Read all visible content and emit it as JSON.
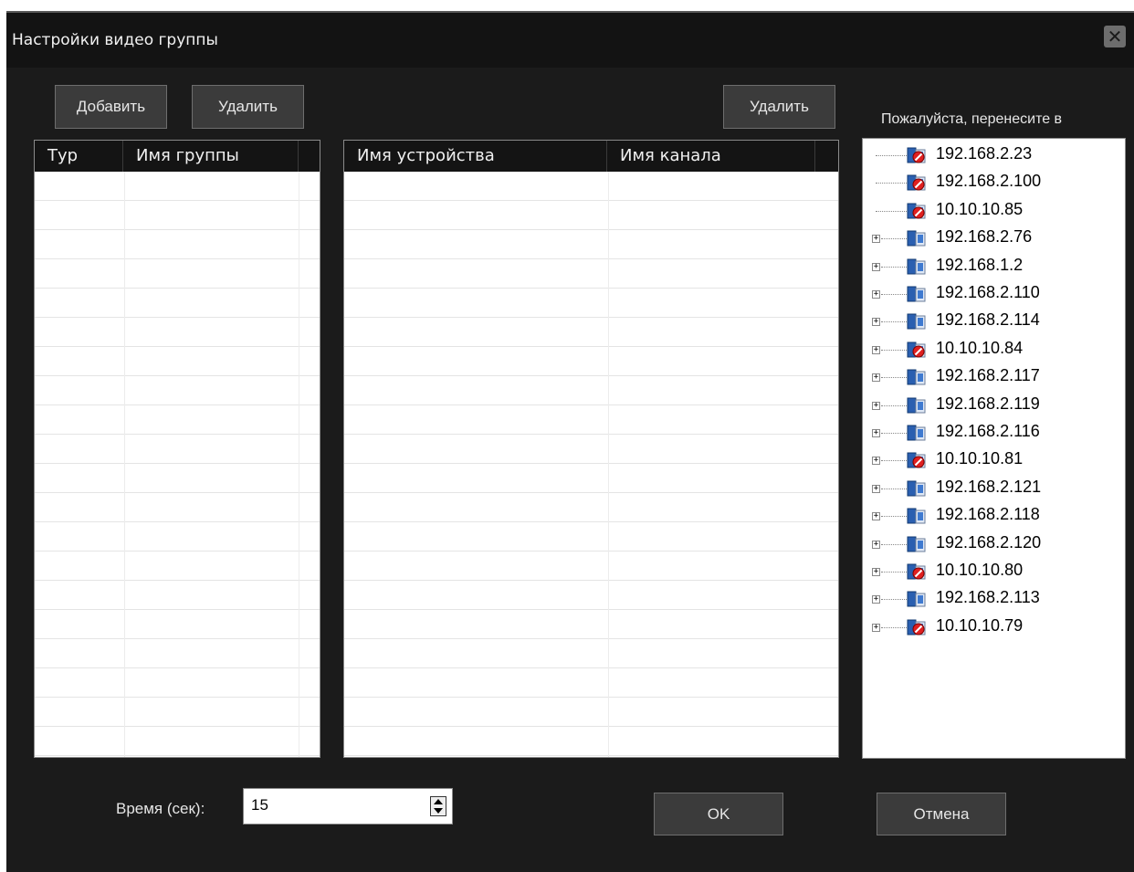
{
  "dialog": {
    "title": "Настройки видео группы",
    "close_icon": "close-icon"
  },
  "left_toolbar": {
    "add_label": "Добавить",
    "delete_label": "Удалить"
  },
  "middle_toolbar": {
    "delete_label": "Удалить"
  },
  "groups_table": {
    "columns": [
      "Тур",
      "Имя группы"
    ]
  },
  "channels_table": {
    "columns": [
      "Имя устройства",
      "Имя канала"
    ]
  },
  "device_tree": {
    "hint": "Пожалуйста, перенесите в",
    "nodes": [
      {
        "ip": "192.168.2.23",
        "status": "offline",
        "expandable": false
      },
      {
        "ip": "192.168.2.100",
        "status": "offline",
        "expandable": false
      },
      {
        "ip": "10.10.10.85",
        "status": "offline",
        "expandable": false
      },
      {
        "ip": "192.168.2.76",
        "status": "online",
        "expandable": true
      },
      {
        "ip": "192.168.1.2",
        "status": "online",
        "expandable": true
      },
      {
        "ip": "192.168.2.110",
        "status": "online",
        "expandable": true
      },
      {
        "ip": "192.168.2.114",
        "status": "online",
        "expandable": true
      },
      {
        "ip": "10.10.10.84",
        "status": "offline",
        "expandable": true
      },
      {
        "ip": "192.168.2.117",
        "status": "online",
        "expandable": true
      },
      {
        "ip": "192.168.2.119",
        "status": "online",
        "expandable": true
      },
      {
        "ip": "192.168.2.116",
        "status": "online",
        "expandable": true
      },
      {
        "ip": "10.10.10.81",
        "status": "offline",
        "expandable": true
      },
      {
        "ip": "192.168.2.121",
        "status": "online",
        "expandable": true
      },
      {
        "ip": "192.168.2.118",
        "status": "online",
        "expandable": true
      },
      {
        "ip": "192.168.2.120",
        "status": "online",
        "expandable": true
      },
      {
        "ip": "10.10.10.80",
        "status": "offline",
        "expandable": true
      },
      {
        "ip": "192.168.2.113",
        "status": "online",
        "expandable": true
      },
      {
        "ip": "10.10.10.79",
        "status": "offline",
        "expandable": true
      }
    ]
  },
  "time": {
    "label": "Время (сек):",
    "value": "15"
  },
  "footer": {
    "ok_label": "OK",
    "cancel_label": "Отмена"
  },
  "colors": {
    "background": "#1b1b1b",
    "titlebar": "#131313",
    "button": "#3b3b3b",
    "offline_badge": "#e02020",
    "device_blue": "#2a5fb0"
  }
}
